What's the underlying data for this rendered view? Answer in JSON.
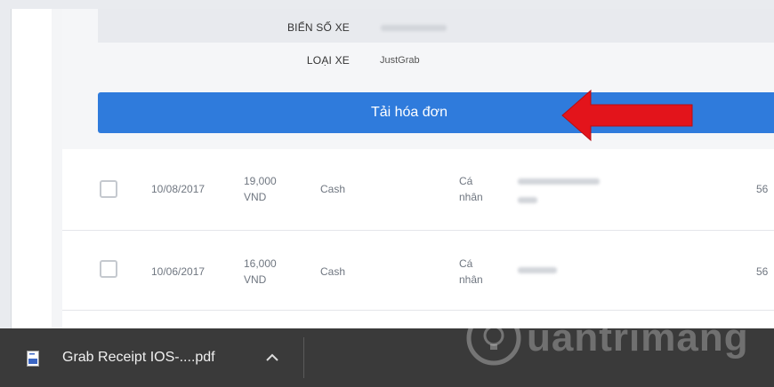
{
  "vehicle_info": {
    "plate_label": "BIỂN SỐ XE",
    "type_label": "LOẠI XE",
    "type_value": "JustGrab"
  },
  "download_button": {
    "label": "Tải hóa đơn"
  },
  "trips": [
    {
      "date": "10/08/2017",
      "amount": "19,000",
      "currency": "VND",
      "payment": "Cash",
      "type_line1": "Cá",
      "type_line2": "nhân",
      "last": "56"
    },
    {
      "date": "10/06/2017",
      "amount": "16,000",
      "currency": "VND",
      "payment": "Cash",
      "type_line1": "Cá",
      "type_line2": "nhân",
      "last": "56"
    }
  ],
  "downloads_bar": {
    "file_name": "Grab Receipt IOS-....pdf"
  },
  "watermark": {
    "text": "uantrimang"
  },
  "colors": {
    "button": "#2f7bdc",
    "arrow": "#e3141b",
    "downloads_bar": "#3a3a3a"
  }
}
